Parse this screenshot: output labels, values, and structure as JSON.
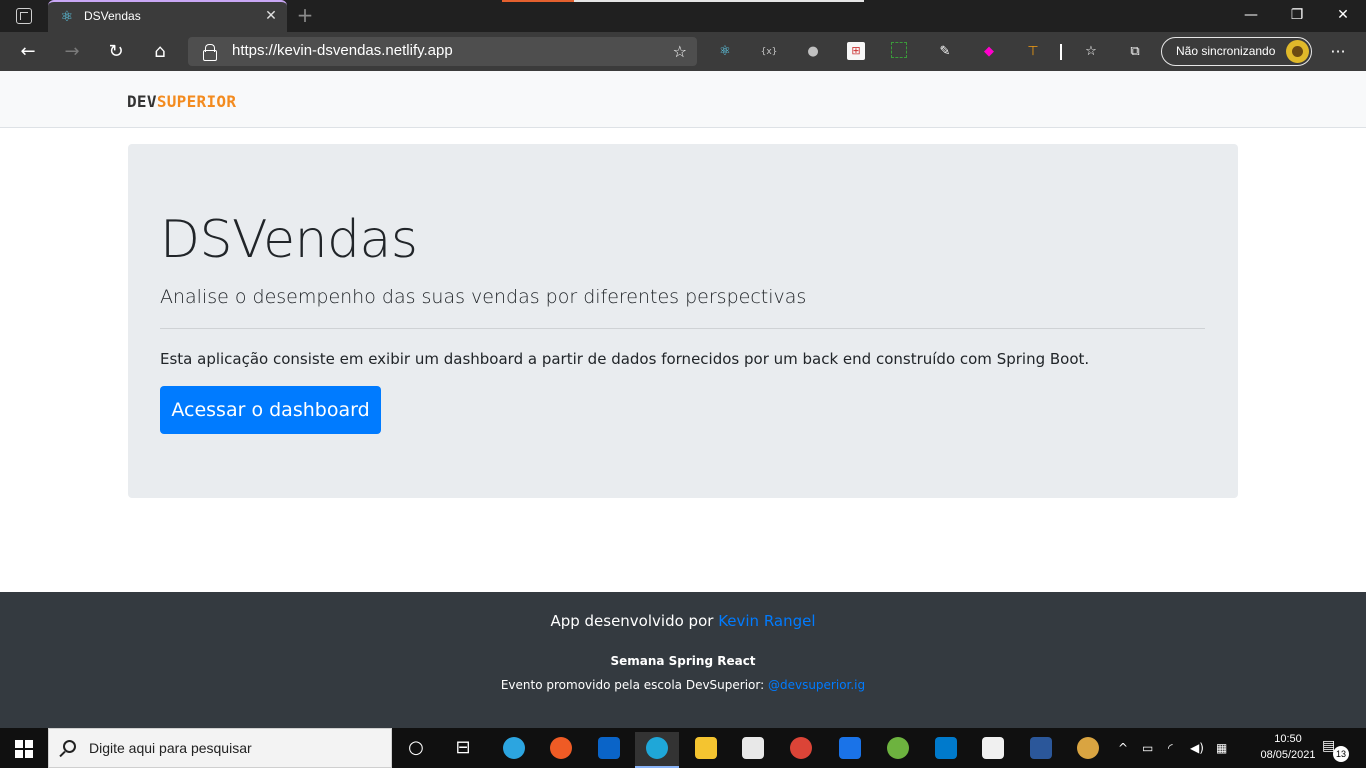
{
  "browser": {
    "tab": {
      "title": "DSVendas"
    },
    "address": {
      "url_scheme": "https://",
      "url_host": "kevin-dsvendas.netlify.app"
    },
    "profile_label": "Não sincronizando"
  },
  "site": {
    "logo": {
      "part1": "DEV",
      "part2": "SUPERIOR"
    },
    "jumbotron": {
      "title": "DSVendas",
      "lead": "Analise o desempenho das suas vendas por diferentes perspectivas",
      "description": "Esta aplicação consiste em exibir um dashboard a partir de dados fornecidos por um back end construído com Spring Boot.",
      "button_label": "Acessar o dashboard"
    },
    "footer": {
      "line1_prefix": "App desenvolvido por ",
      "line1_author": "Kevin Rangel",
      "line2": "Semana Spring React",
      "line3_prefix": "Evento promovido pela escola DevSuperior: ",
      "line3_link": "@devsuperior.ig"
    }
  },
  "taskbar": {
    "search_placeholder": "Digite aqui para pesquisar",
    "time": "10:50",
    "date": "08/05/2021",
    "notification_count": "13"
  },
  "colors": {
    "accent": "#007bff",
    "brand_orange": "#f38b1f",
    "footer_bg": "#343a40",
    "jumbotron_bg": "#e9ecef"
  }
}
